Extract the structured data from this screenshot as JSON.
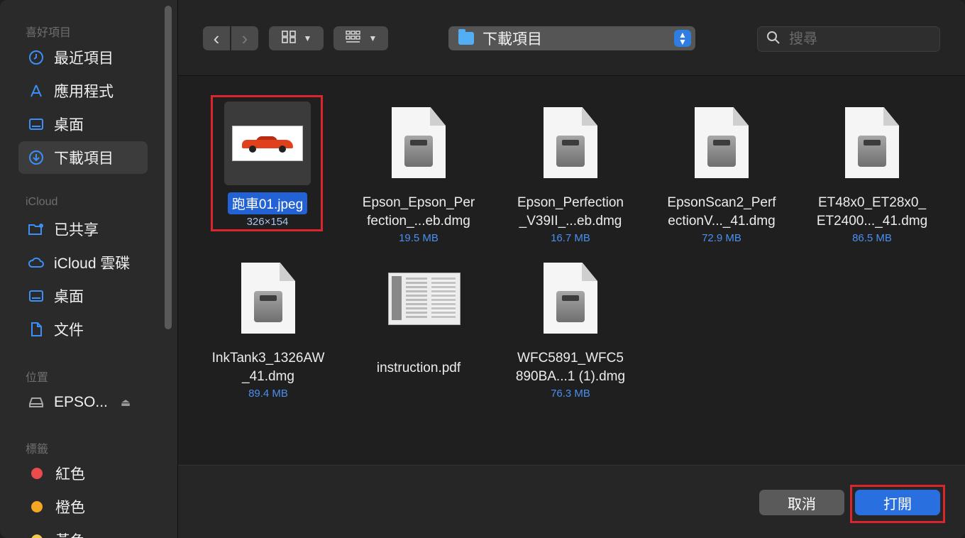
{
  "sidebar": {
    "favorites_header": "喜好項目",
    "favorites": [
      {
        "label": "最近項目",
        "icon": "clock-icon"
      },
      {
        "label": "應用程式",
        "icon": "apps-icon"
      },
      {
        "label": "桌面",
        "icon": "desktop-icon"
      },
      {
        "label": "下載項目",
        "icon": "download-icon",
        "selected": true
      }
    ],
    "icloud_header": "iCloud",
    "icloud": [
      {
        "label": "已共享",
        "icon": "shared-folder-icon"
      },
      {
        "label": "iCloud 雲碟",
        "icon": "cloud-icon"
      },
      {
        "label": "桌面",
        "icon": "desktop-icon"
      },
      {
        "label": "文件",
        "icon": "document-icon"
      }
    ],
    "locations_header": "位置",
    "locations": [
      {
        "label": "EPSO...",
        "icon": "drive-icon"
      }
    ],
    "tags_header": "標籤",
    "tags": [
      {
        "label": "紅色",
        "color": "#ea4b4b"
      },
      {
        "label": "橙色",
        "color": "#f5a623"
      },
      {
        "label": "黃色",
        "color": "#f2c94c"
      }
    ]
  },
  "toolbar": {
    "back_icon": "‹",
    "forward_icon": "›",
    "view_icon": "grid-view-icon",
    "group_icon": "group-icon",
    "path_label": "下載項目",
    "search_placeholder": "搜尋"
  },
  "files": [
    {
      "name": "跑車01.jpeg",
      "meta": "326×154",
      "type": "image",
      "selected": true
    },
    {
      "name_lines": [
        "Epson_Epson_Per",
        "fection_...eb.dmg"
      ],
      "meta": "19.5 MB",
      "type": "dmg"
    },
    {
      "name_lines": [
        "Epson_Perfection",
        "_V39II_...eb.dmg"
      ],
      "meta": "16.7 MB",
      "type": "dmg"
    },
    {
      "name_lines": [
        "EpsonScan2_Perf",
        "ectionV..._41.dmg"
      ],
      "meta": "72.9 MB",
      "type": "dmg"
    },
    {
      "name_lines": [
        "ET48x0_ET28x0_",
        "ET2400..._41.dmg"
      ],
      "meta": "86.5 MB",
      "type": "dmg"
    },
    {
      "name_lines": [
        "InkTank3_1326AW",
        "_41.dmg"
      ],
      "meta": "89.4 MB",
      "type": "dmg"
    },
    {
      "name_lines": [
        "instruction.pdf"
      ],
      "meta": "",
      "type": "pdf"
    },
    {
      "name_lines": [
        "WFC5891_WFC5",
        "890BA...1 (1).dmg"
      ],
      "meta": "76.3 MB",
      "type": "dmg"
    }
  ],
  "footer": {
    "cancel_label": "取消",
    "open_label": "打開"
  },
  "colors": {
    "accent": "#2a6fe0",
    "highlight_box": "#d8262c"
  }
}
